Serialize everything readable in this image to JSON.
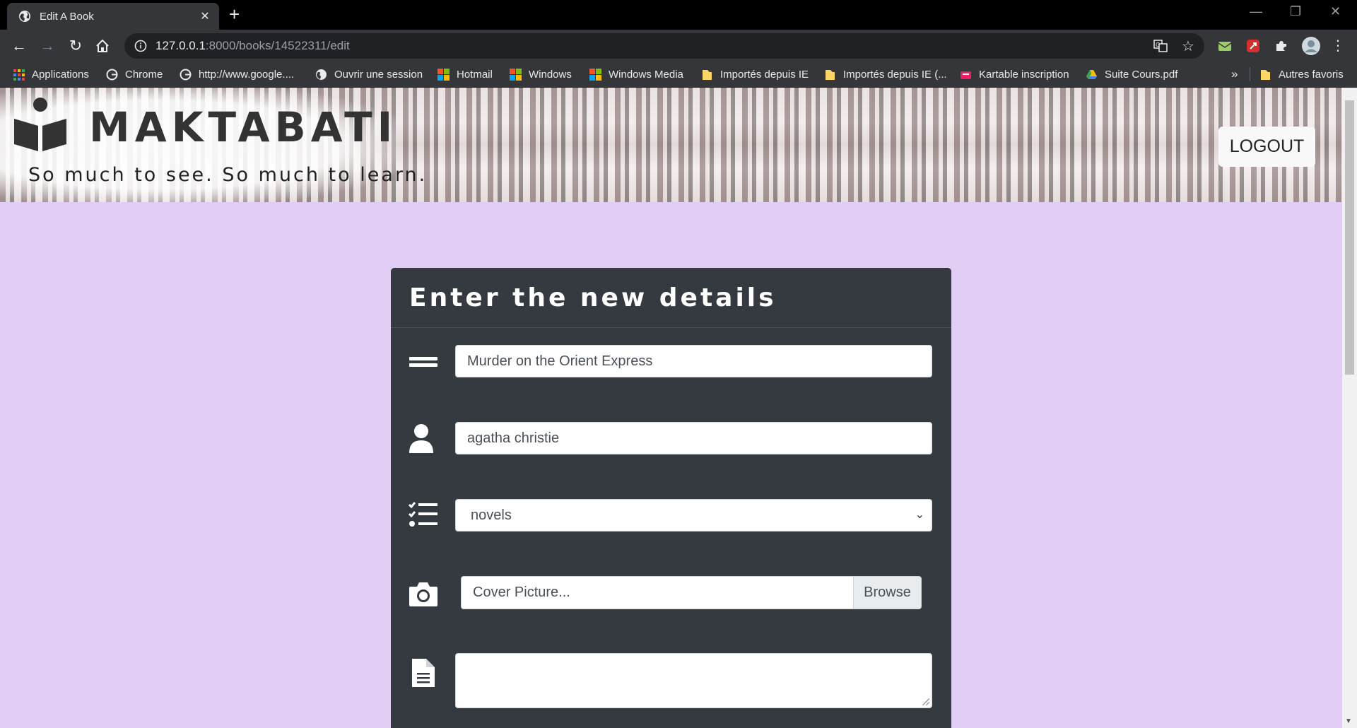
{
  "browser": {
    "tab_title": "Edit A Book",
    "new_tab": "+",
    "url_host": "127.0.0.1",
    "url_rest": ":8000/books/14522311/edit",
    "bookmarks": [
      {
        "label": "Applications",
        "icon": "apps-grid-icon"
      },
      {
        "label": "Chrome",
        "icon": "google-icon"
      },
      {
        "label": "http://www.google....",
        "icon": "google-icon"
      },
      {
        "label": "Ouvrir une session",
        "icon": "globe-icon"
      },
      {
        "label": "Hotmail",
        "icon": "windows-icon"
      },
      {
        "label": "Windows",
        "icon": "windows-icon"
      },
      {
        "label": "Windows Media",
        "icon": "windows-icon"
      },
      {
        "label": "Importés depuis IE",
        "icon": "folder-icon"
      },
      {
        "label": "Importés depuis IE (...",
        "icon": "folder-icon"
      },
      {
        "label": "Kartable inscription",
        "icon": "kartable-icon"
      },
      {
        "label": "Suite Cours.pdf",
        "icon": "drive-icon"
      }
    ],
    "more_bookmarks": "»",
    "other_bookmarks": "Autres favoris"
  },
  "header": {
    "brand": "MAKTABATI",
    "tagline": "So much to see. So much to learn.",
    "logout_label": "LOGOUT"
  },
  "form": {
    "title": "Enter the new details",
    "book_title_value": "Murder on the Orient Express",
    "author_value": "agatha christie",
    "category_value": "novels",
    "cover_placeholder": "Cover Picture...",
    "browse_label": "Browse",
    "description_value": ""
  },
  "colors": {
    "page_background": "#e1ccf3",
    "card_background": "#343a40",
    "browser_chrome": "#35363a"
  }
}
